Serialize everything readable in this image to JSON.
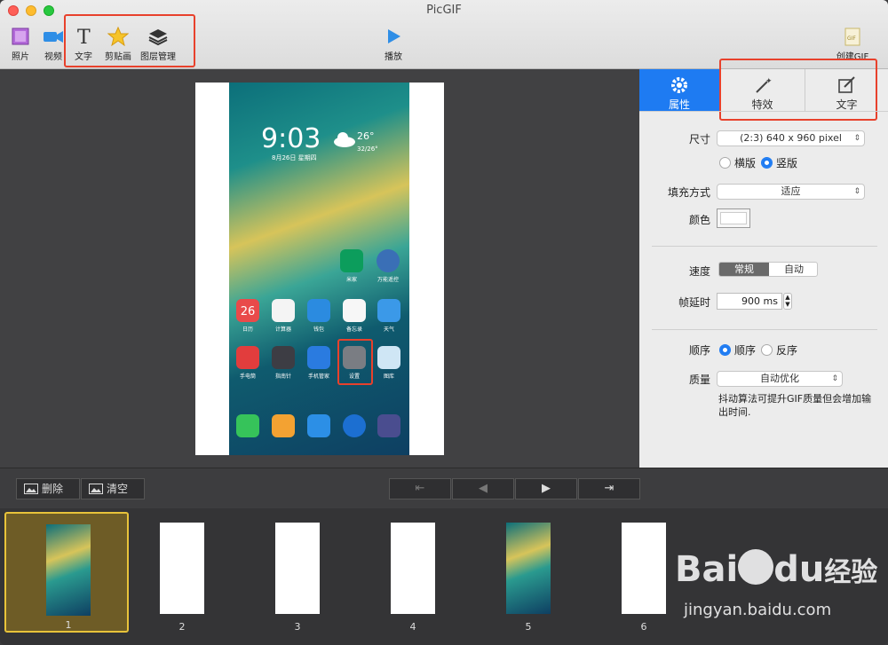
{
  "window": {
    "title": "PicGIF"
  },
  "toolbar": {
    "photo": "照片",
    "video": "视频",
    "text": "文字",
    "clip_art": "剪贴画",
    "layer_manage": "图层管理",
    "play": "播放",
    "create_gif": "创建GIF"
  },
  "phone_screen": {
    "time": "9:03",
    "temp": "26°",
    "temp_range": "32/26°",
    "date": "8月26日 星期四",
    "apps": [
      "米家",
      "万能遥控",
      "日历",
      "计算器",
      "钱包",
      "备忘录",
      "天气",
      "手电筒",
      "指南针",
      "手机管家",
      "设置",
      "图库"
    ],
    "calendar_day": "26"
  },
  "panel": {
    "tabs": [
      "属性",
      "特效",
      "文字"
    ],
    "size_label": "尺寸",
    "size_value": "(2:3) 640 x 960 pixel",
    "orient_landscape": "横版",
    "orient_portrait": "竖版",
    "fill_label": "填充方式",
    "fill_value": "适应",
    "color_label": "颜色",
    "speed_label": "速度",
    "speed_normal": "常规",
    "speed_auto": "自动",
    "delay_label": "帧延时",
    "delay_value": "900 ms",
    "order_label": "顺序",
    "order_seq": "顺序",
    "order_rev": "反序",
    "quality_label": "质量",
    "quality_value": "自动优化",
    "quality_note": "抖动算法可提升GIF质量但会增加输出时间."
  },
  "bottom": {
    "delete": "删除",
    "clear": "清空"
  },
  "frames": [
    "1",
    "2",
    "3",
    "4",
    "5",
    "6"
  ],
  "watermark": {
    "brand_bai": "Bai",
    "brand_du": "du",
    "brand_jy": "经验",
    "url": "jingyan.baidu.com"
  },
  "colors": {
    "accent": "#1e7bf2",
    "highlight": "#e8412c",
    "selected_frame": "#e8c33a"
  }
}
